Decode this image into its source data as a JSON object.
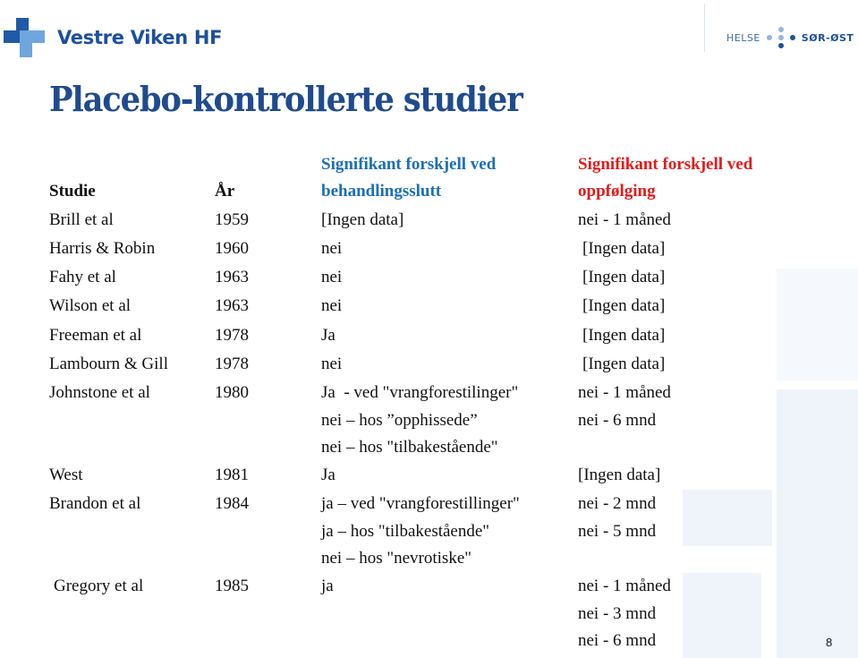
{
  "header": {
    "org_name": "Vestre Viken HF",
    "partner_logo": {
      "left_text": "HELSE",
      "right_text": "SØR-ØST"
    }
  },
  "slide": {
    "title": "Placebo-kontrollerte studier",
    "page_number": "8"
  },
  "colors": {
    "title": "#1f4b8e",
    "header_end_of_treatment": "#1a6fb5",
    "header_follow_up": "#e21b1b",
    "background_shapes": "#eef4fa"
  },
  "table": {
    "headers": {
      "study": "Studie",
      "year": "År",
      "end_of_treatment_line1": "Signifikant forskjell ved",
      "end_of_treatment_line2": "behandlingsslutt",
      "follow_up_line1": "Signifikant forskjell ved",
      "follow_up_line2": "oppfølging"
    },
    "rows": [
      {
        "study": "Brill et al",
        "year": "1959",
        "end_of_treatment": [
          "[Ingen data]"
        ],
        "follow_up": [
          "nei - 1 måned"
        ]
      },
      {
        "study": "Harris & Robin",
        "year": "1960",
        "end_of_treatment": [
          "nei"
        ],
        "follow_up": [
          "[Ingen data]"
        ]
      },
      {
        "study": "Fahy et al",
        "year": "1963",
        "end_of_treatment": [
          "nei"
        ],
        "follow_up": [
          "[Ingen data]"
        ]
      },
      {
        "study": "Wilson et al",
        "year": "1963",
        "end_of_treatment": [
          "nei"
        ],
        "follow_up": [
          "[Ingen data]"
        ]
      },
      {
        "study": "Freeman et al",
        "year": "1978",
        "end_of_treatment": [
          "Ja"
        ],
        "follow_up": [
          "[Ingen data]"
        ]
      },
      {
        "study": "Lambourn & Gill",
        "year": "1978",
        "end_of_treatment": [
          "nei"
        ],
        "follow_up": [
          "[Ingen data]"
        ]
      },
      {
        "study": "Johnstone et al",
        "year": "1980",
        "end_of_treatment": [
          "Ja  - ved \"vrangforestilinger\"",
          "nei – hos ”opphissede”",
          "nei – hos \"tilbakestående\""
        ],
        "follow_up": [
          "nei - 1 måned",
          "nei - 6 mnd"
        ]
      },
      {
        "study": "West",
        "year": "1981",
        "end_of_treatment": [
          "Ja"
        ],
        "follow_up": [
          "[Ingen data]"
        ]
      },
      {
        "study": "Brandon et al",
        "year": "1984",
        "end_of_treatment": [
          "ja – ved \"vrangforestillinger\"",
          "ja – hos \"tilbakestående\"",
          "nei – hos \"nevrotiske\""
        ],
        "follow_up": [
          "nei - 2 mnd",
          "nei - 5 mnd"
        ]
      },
      {
        "study": "Gregory et al",
        "year": "1985",
        "end_of_treatment": [
          "ja"
        ],
        "follow_up": [
          "nei - 1 måned",
          "nei - 3 mnd",
          "nei - 6 mnd"
        ]
      }
    ]
  }
}
